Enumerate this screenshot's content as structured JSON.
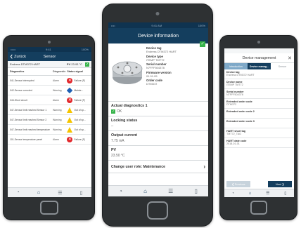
{
  "left": {
    "status": {
      "carrier": "•••••",
      "time": "9:41",
      "battery": "100%"
    },
    "nav": {
      "back": "❮ Zurück",
      "title": "Sensor"
    },
    "device": {
      "name": "Endress DTM372 HART",
      "pv_label": "PV",
      "pv_value": "23.93 °C"
    },
    "table": {
      "headers": [
        "Diagnostics",
        "Diagnostic",
        "Status signal"
      ],
      "rows": [
        {
          "diag": "041-Sensor interrupted",
          "type": "Alarm",
          "signal": "alarm",
          "signal_text": "Failure (F)"
        },
        {
          "diag": "042-Sensor corroded",
          "type": "Warning",
          "signal": "diamond",
          "signal_text": "Mainte..."
        },
        {
          "diag": "043-Short circuit",
          "type": "Alarm",
          "signal": "alarm",
          "signal_text": "Failure (F)"
        },
        {
          "diag": "047-Sensor limit reached Sensor 1",
          "type": "Warning",
          "signal": "warn",
          "signal_text": "Out of sp..."
        },
        {
          "diag": "047-Sensor limit reached Sensor 2",
          "type": "Warning",
          "signal": "warn",
          "signal_text": "Out of sp..."
        },
        {
          "diag": "047-Sensor limit reached temperature",
          "type": "Warning",
          "signal": "warn",
          "signal_text": "Out of sp..."
        },
        {
          "diag": "101-Sensor temperature panel",
          "type": "Alarm",
          "signal": "alarm",
          "signal_text": "Failure (F)"
        }
      ]
    }
  },
  "center": {
    "status": {
      "carrier": "•••• ",
      "time": "9:41 AM",
      "battery": "100%"
    },
    "title": "Device information",
    "device": {
      "tag_label": "Device tag",
      "tag_value": "Endress DTM372 HART",
      "type_label": "Device type",
      "type_value": "iTEMP TMT72",
      "serial_label": "Serial number",
      "serial_value": "N7FFF504378",
      "fw_label": "Firmware version",
      "fw_value": "01.01.05",
      "order_label": "Order code",
      "order_value": "DTM372"
    },
    "sections": {
      "diag_label": "Actual diagnostics 1",
      "diag_value": "OK",
      "locking_label": "Locking status",
      "locking_value": "--",
      "output_label": "Output current",
      "output_value": "7.75 mA",
      "pv_label": "PV",
      "pv_value": "23.50 °C",
      "change_label": "Change user role: Maintenance",
      "change_chevron": "›"
    },
    "tabs": [
      "gauge-icon",
      "home-icon",
      "menu-icon",
      "device-icon"
    ]
  },
  "right": {
    "title": "Device management",
    "close": "✕",
    "steps": [
      "Introduction",
      "Device manag...",
      "Sensor"
    ],
    "fields": [
      {
        "label": "Device tag",
        "value": "Endress DTM372 HART"
      },
      {
        "label": "Device name",
        "value": "iTEMP TMT72"
      },
      {
        "label": "Serial number",
        "value": "N7FFF504378"
      },
      {
        "label": "Extended order code",
        "value": "DTM372"
      },
      {
        "label": "Extended order code 2",
        "value": ""
      },
      {
        "label": "Extended order code 3",
        "value": ""
      },
      {
        "label": "HART short tag",
        "value": "TMT72_TAG"
      },
      {
        "label": "HART date code",
        "value": "2018-01-01"
      }
    ],
    "buttons": {
      "prev": "❮  Previous",
      "next": "Next  ❯"
    }
  }
}
